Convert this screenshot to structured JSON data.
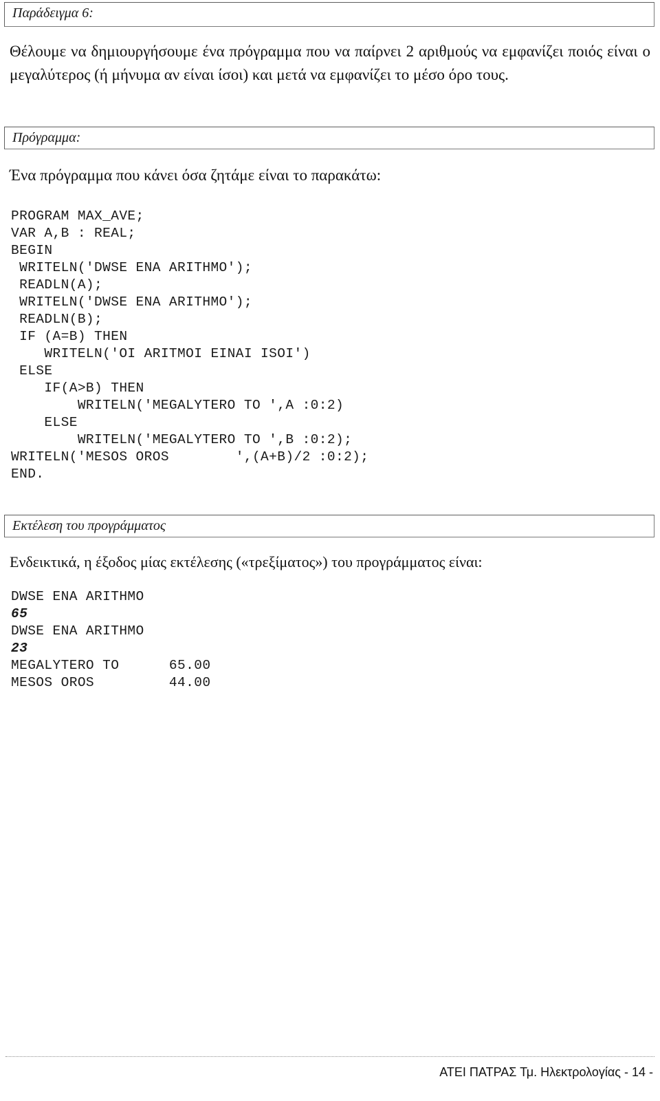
{
  "document": {
    "sections": {
      "example_heading": "Παράδειγμα 6:",
      "program_heading": "Πρόγραμμα:",
      "run_heading": "Εκτέλεση του προγράμματος"
    },
    "paragraphs": {
      "intro": "Θέλουμε να δημιουργήσουμε ένα πρόγραμμα που να παίρνει 2 αριθμούς να εμφανίζει ποιός είναι ο μεγαλύτερος (ή μήνυμα αν είναι ίσοι) και μετά να εμφανίζει το μέσο όρο τους.",
      "program_lead": "Ένα πρόγραμμα που κάνει όσα ζητάμε είναι το παρακάτω:",
      "output_lead": "Ενδεικτικά,  η έξοδος μίας εκτέλεσης («τρεξίματος») του προγράμματος είναι:"
    },
    "code": {
      "language": "Pascal",
      "lines": [
        "PROGRAM MAX_AVE;",
        "VAR A,B : REAL;",
        "BEGIN",
        " WRITELN('DWSE ENA ARITHMO');",
        " READLN(A);",
        " WRITELN('DWSE ENA ARITHMO');",
        " READLN(B);",
        " IF (A=B) THEN",
        "    WRITELN('OI ARITMOI EINAI ISOI')",
        " ELSE",
        "    IF(A>B) THEN",
        "        WRITELN('MEGALYTERO TO ',A :0:2)",
        "    ELSE",
        "        WRITELN('MEGALYTERO TO ',B :0:2);",
        "WRITELN('MESOS OROS        ',(A+B)/2 :0:2);",
        "END."
      ]
    },
    "console": {
      "lines": [
        {
          "text": "DWSE ENA ARITHMO",
          "kind": "program-output"
        },
        {
          "text": "65",
          "kind": "user-input"
        },
        {
          "text": "DWSE ENA ARITHMO",
          "kind": "program-output"
        },
        {
          "text": "23",
          "kind": "user-input"
        },
        {
          "text": "MEGALYTERO TO      65.00",
          "kind": "program-output"
        },
        {
          "text": "MESOS OROS         44.00",
          "kind": "program-output"
        }
      ]
    },
    "footer": {
      "text": "ΑΤΕΙ ΠΑΤΡΑΣ Τμ. Ηλεκτρολογίας - 14 -"
    }
  }
}
